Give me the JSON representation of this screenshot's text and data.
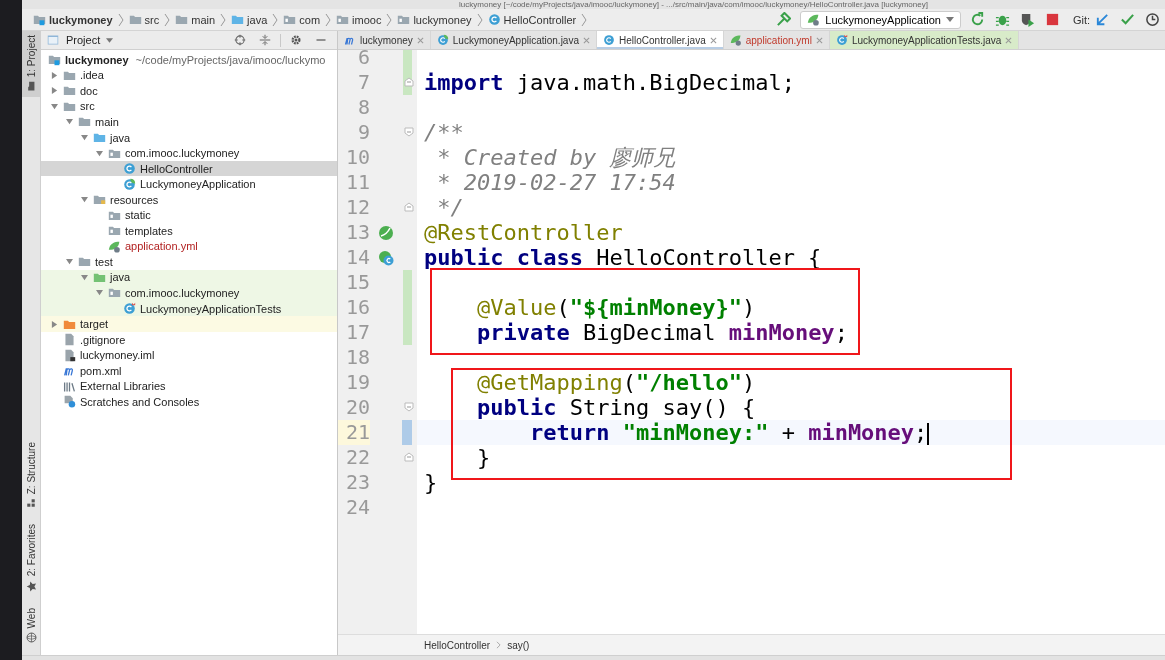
{
  "window": {
    "title": "luckymoney [~/code/myProjects/java/imooc/luckymoney] - .../src/main/java/com/imooc/luckymoney/HelloController.java [luckymoney]"
  },
  "breadcrumbs": [
    {
      "label": "luckymoney",
      "kind": "module",
      "bold": true
    },
    {
      "label": "src",
      "kind": "folder",
      "bold": false
    },
    {
      "label": "main",
      "kind": "folder",
      "bold": false
    },
    {
      "label": "java",
      "kind": "source-folder",
      "bold": false
    },
    {
      "label": "com",
      "kind": "package",
      "bold": false
    },
    {
      "label": "imooc",
      "kind": "package",
      "bold": false
    },
    {
      "label": "luckymoney",
      "kind": "package",
      "bold": false
    },
    {
      "label": "HelloController",
      "kind": "class",
      "bold": false
    }
  ],
  "toolbar": {
    "run_config": "LuckymoneyApplication",
    "git_label": "Git:"
  },
  "tool_strip": {
    "top": [
      {
        "label": "1: Project",
        "selected": true
      }
    ],
    "bottom": [
      {
        "label": "Z: Structure",
        "kind": "structure",
        "selected": false
      },
      {
        "label": "2: Favorites",
        "kind": "star",
        "selected": false
      },
      {
        "label": "Web",
        "kind": "globe",
        "selected": false
      }
    ]
  },
  "project_panel": {
    "title": "Project",
    "root": {
      "label": "luckymoney",
      "path": "~/code/myProjects/java/imooc/luckymo"
    },
    "tree": [
      {
        "label": ".idea",
        "kind": "folder",
        "expanded": false,
        "selected": false,
        "test": false,
        "excluded": false
      },
      {
        "label": "doc",
        "kind": "folder",
        "expanded": false,
        "selected": false,
        "test": false,
        "excluded": false
      },
      {
        "label": "src",
        "kind": "folder",
        "expanded": true,
        "selected": false,
        "test": false,
        "excluded": false,
        "children": [
          {
            "label": "main",
            "kind": "folder",
            "expanded": true,
            "selected": false,
            "test": false,
            "excluded": false,
            "children": [
              {
                "label": "java",
                "kind": "source-folder",
                "expanded": true,
                "selected": false,
                "test": false,
                "excluded": false,
                "children": [
                  {
                    "label": "com.imooc.luckymoney",
                    "kind": "package",
                    "expanded": true,
                    "selected": false,
                    "test": false,
                    "excluded": false,
                    "children": [
                      {
                        "label": "HelloController",
                        "kind": "class",
                        "selected": true,
                        "test": false,
                        "excluded": false
                      },
                      {
                        "label": "LuckymoneyApplication",
                        "kind": "spring-class",
                        "selected": false,
                        "test": false,
                        "excluded": false
                      }
                    ]
                  }
                ]
              },
              {
                "label": "resources",
                "kind": "resources-folder",
                "expanded": true,
                "selected": false,
                "test": false,
                "excluded": false,
                "children": [
                  {
                    "label": "static",
                    "kind": "package",
                    "selected": false,
                    "test": false,
                    "excluded": false
                  },
                  {
                    "label": "templates",
                    "kind": "package",
                    "selected": false,
                    "test": false,
                    "excluded": false
                  },
                  {
                    "label": "application.yml",
                    "kind": "yml",
                    "selected": false,
                    "test": false,
                    "excluded": false,
                    "color": "#b22222"
                  }
                ]
              }
            ]
          },
          {
            "label": "test",
            "kind": "folder",
            "expanded": true,
            "selected": false,
            "test": false,
            "excluded": false,
            "children": [
              {
                "label": "java",
                "kind": "test-folder",
                "expanded": true,
                "selected": false,
                "test": true,
                "excluded": false,
                "children": [
                  {
                    "label": "com.imooc.luckymoney",
                    "kind": "package",
                    "expanded": true,
                    "selected": false,
                    "test": true,
                    "excluded": false,
                    "children": [
                      {
                        "label": "LuckymoneyApplicationTests",
                        "kind": "test-class",
                        "selected": false,
                        "test": true,
                        "excluded": false
                      }
                    ]
                  }
                ]
              }
            ]
          }
        ]
      },
      {
        "label": "target",
        "kind": "excluded-folder",
        "expanded": false,
        "selected": false,
        "test": false,
        "excluded": true
      },
      {
        "label": ".gitignore",
        "kind": "file",
        "selected": false,
        "test": false,
        "excluded": false
      },
      {
        "label": "luckymoney.iml",
        "kind": "iml",
        "selected": false,
        "test": false,
        "excluded": false
      },
      {
        "label": "pom.xml",
        "kind": "maven",
        "selected": false,
        "test": false,
        "excluded": false
      },
      {
        "label": "External Libraries",
        "kind": "libraries",
        "selected": false,
        "test": false,
        "excluded": false
      },
      {
        "label": "Scratches and Consoles",
        "kind": "scratches",
        "selected": false,
        "test": false,
        "excluded": false
      }
    ]
  },
  "tabs": [
    {
      "label": "luckymoney",
      "kind": "maven",
      "selected": false,
      "error": false,
      "test": false
    },
    {
      "label": "LuckymoneyApplication.java",
      "kind": "spring-class",
      "selected": false,
      "error": false,
      "test": false
    },
    {
      "label": "HelloController.java",
      "kind": "class",
      "selected": true,
      "error": false,
      "test": false
    },
    {
      "label": "application.yml",
      "kind": "yml",
      "selected": false,
      "error": true,
      "test": false
    },
    {
      "label": "LuckymoneyApplicationTests.java",
      "kind": "test-class",
      "selected": false,
      "error": false,
      "test": true
    }
  ],
  "editor": {
    "lines": [
      {
        "number": "6",
        "kind": "plain",
        "current": false,
        "boxed": false,
        "changed": true,
        "fold_start": false,
        "fold_end": false
      },
      {
        "number": "7",
        "kind": "plain",
        "current": false,
        "boxed": false,
        "changed": true,
        "fold_start": false,
        "fold_end": true,
        "tokens": [
          {
            "kind": "kw",
            "text": "import"
          },
          {
            "kind": "plain",
            "text": " java.math.BigDecimal;"
          }
        ]
      },
      {
        "number": "8",
        "kind": "plain",
        "current": false,
        "boxed": false,
        "changed": false,
        "fold_start": false,
        "fold_end": false
      },
      {
        "number": "9",
        "kind": "plain",
        "current": false,
        "boxed": false,
        "changed": false,
        "fold_start": true,
        "fold_end": false,
        "tokens": [
          {
            "kind": "comment",
            "text": "/**"
          }
        ]
      },
      {
        "number": "10",
        "kind": "plain",
        "current": false,
        "boxed": false,
        "changed": false,
        "fold_start": false,
        "fold_end": false,
        "tokens": [
          {
            "kind": "comment",
            "text": " * Created by 廖师兄"
          }
        ]
      },
      {
        "number": "11",
        "kind": "plain",
        "current": false,
        "boxed": false,
        "changed": false,
        "fold_start": false,
        "fold_end": false,
        "tokens": [
          {
            "kind": "comment",
            "text": " * 2019-02-27 17:54"
          }
        ]
      },
      {
        "number": "12",
        "kind": "plain",
        "current": false,
        "boxed": false,
        "changed": false,
        "fold_start": false,
        "fold_end": true,
        "tokens": [
          {
            "kind": "comment",
            "text": " */"
          }
        ]
      },
      {
        "number": "13",
        "kind": "bean",
        "current": false,
        "boxed": false,
        "changed": false,
        "fold_start": false,
        "fold_end": false,
        "tokens": [
          {
            "kind": "annotation",
            "text": "@RestController"
          }
        ]
      },
      {
        "number": "14",
        "kind": "class",
        "current": false,
        "boxed": false,
        "changed": false,
        "fold_start": false,
        "fold_end": false,
        "tokens": [
          {
            "kind": "kw",
            "text": "public class"
          },
          {
            "kind": "plain",
            "text": " HelloController {"
          }
        ]
      },
      {
        "number": "15",
        "kind": "plain",
        "current": false,
        "boxed": true,
        "changed": true,
        "fold_start": false,
        "fold_end": false
      },
      {
        "number": "16",
        "kind": "plain",
        "current": false,
        "boxed": true,
        "changed": true,
        "fold_start": false,
        "fold_end": false,
        "tokens": [
          {
            "kind": "annotation",
            "text": "    @Value"
          },
          {
            "kind": "plain",
            "text": "("
          },
          {
            "kind": "string",
            "text": "\"${minMoney}\""
          },
          {
            "kind": "plain",
            "text": ")"
          }
        ]
      },
      {
        "number": "17",
        "kind": "plain",
        "current": false,
        "boxed": true,
        "changed": true,
        "fold_start": false,
        "fold_end": false,
        "tokens": [
          {
            "kind": "kw",
            "text": "    private"
          },
          {
            "kind": "plain",
            "text": " BigDecimal "
          },
          {
            "kind": "field",
            "text": "minMoney"
          },
          {
            "kind": "plain",
            "text": ";"
          }
        ]
      },
      {
        "number": "18",
        "kind": "plain",
        "current": false,
        "boxed": false,
        "changed": false,
        "fold_start": false,
        "fold_end": false
      },
      {
        "number": "19",
        "kind": "plain",
        "current": false,
        "boxed": true,
        "changed": false,
        "fold_start": false,
        "fold_end": false,
        "tokens": [
          {
            "kind": "annotation",
            "text": "    @GetMapping"
          },
          {
            "kind": "plain",
            "text": "("
          },
          {
            "kind": "string",
            "text": "\"/hello\""
          },
          {
            "kind": "plain",
            "text": ")"
          }
        ]
      },
      {
        "number": "20",
        "kind": "plain",
        "current": false,
        "boxed": true,
        "changed": false,
        "fold_start": true,
        "fold_end": false,
        "tokens": [
          {
            "kind": "kw",
            "text": "    public"
          },
          {
            "kind": "plain",
            "text": " String say() {"
          }
        ]
      },
      {
        "number": "21",
        "kind": "plain",
        "current": true,
        "boxed": true,
        "changed": false,
        "fold_start": false,
        "fold_end": false,
        "tokens": [
          {
            "kind": "kw",
            "text": "        return "
          },
          {
            "kind": "string",
            "text": "\"minMoney:\""
          },
          {
            "kind": "plain",
            "text": " + "
          },
          {
            "kind": "field",
            "text": "minMoney"
          },
          {
            "kind": "plain",
            "text": ";"
          }
        ]
      },
      {
        "number": "22",
        "kind": "plain",
        "current": false,
        "boxed": true,
        "changed": false,
        "fold_start": false,
        "fold_end": true,
        "tokens": [
          {
            "kind": "plain",
            "text": "    }"
          }
        ]
      },
      {
        "number": "23",
        "kind": "plain",
        "current": false,
        "boxed": false,
        "changed": false,
        "fold_start": false,
        "fold_end": false,
        "tokens": [
          {
            "kind": "plain",
            "text": "}"
          }
        ]
      },
      {
        "number": "24",
        "kind": "plain",
        "current": false,
        "boxed": false,
        "changed": false,
        "fold_start": false,
        "fold_end": false
      }
    ],
    "breadcrumb": [
      "HelloController",
      "say()"
    ]
  }
}
